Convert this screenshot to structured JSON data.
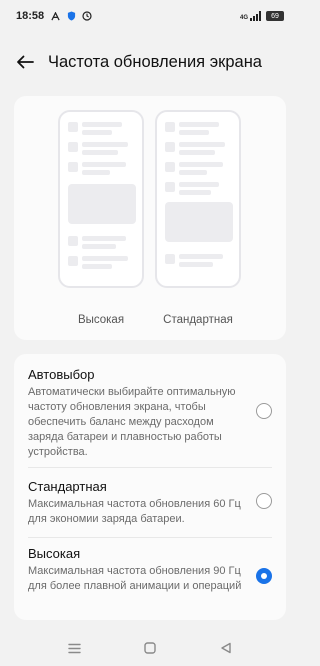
{
  "status_bar": {
    "time": "18:58",
    "left_icons": [
      "font-a-icon",
      "shield-icon",
      "clock-icon"
    ],
    "network": "4G",
    "battery": "69"
  },
  "header": {
    "title": "Частота обновления экрана",
    "back_icon": "arrow-left-icon"
  },
  "preview": {
    "left_label": "Высокая",
    "right_label": "Стандартная"
  },
  "options": [
    {
      "title": "Автовыбор",
      "description": "Автоматически выбирайте оптимальную частоту обновления экрана, чтобы обеспечить баланс между расходом заряда батареи и плавностью работы устройства.",
      "selected": false
    },
    {
      "title": "Стандартная",
      "description": "Максимальная частота обновления 60 Гц для экономии заряда батареи.",
      "selected": false
    },
    {
      "title": "Высокая",
      "description": "Максимальная частота обновления 90 Гц для более плавной анимации и операций",
      "selected": true
    }
  ],
  "colors": {
    "accent": "#1a73e8",
    "background": "#f2f2f2",
    "card": "#fbfbfb"
  },
  "nav": [
    "menu-icon",
    "home-icon",
    "back-triangle-icon"
  ]
}
